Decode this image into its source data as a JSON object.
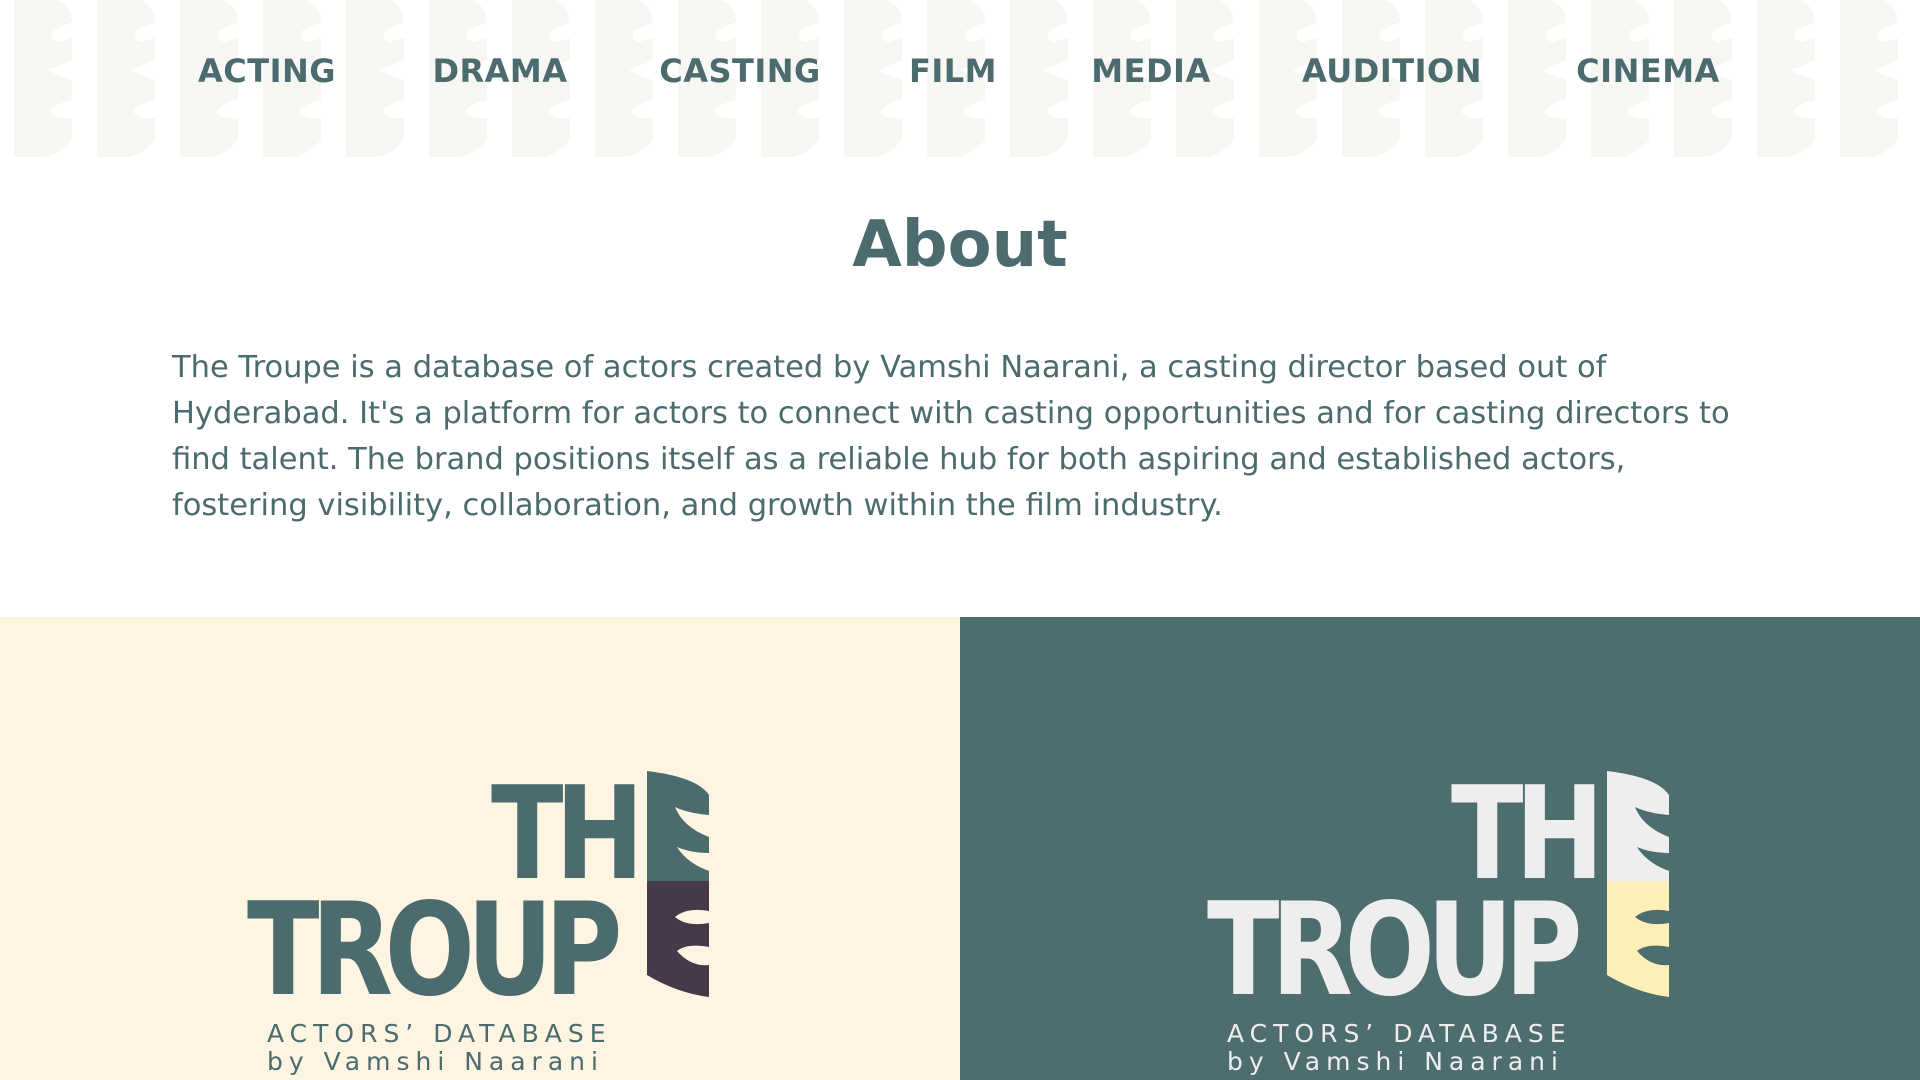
{
  "colors": {
    "teal": "#4b6b6e",
    "cream": "#fdf4e1",
    "plum": "#45394a",
    "light": "#eeeeee",
    "butter": "#fdefb8",
    "pattern": "#f6f6f3"
  },
  "nav": {
    "items": [
      {
        "label": "ACTING"
      },
      {
        "label": "DRAMA"
      },
      {
        "label": "CASTING"
      },
      {
        "label": "FILM"
      },
      {
        "label": "MEDIA"
      },
      {
        "label": "AUDITION"
      },
      {
        "label": "CINEMA"
      }
    ]
  },
  "about": {
    "title": "About",
    "body": "The Troupe is a database of actors created by Vamshi Naarani, a casting director based out of Hyderabad. It's a platform for actors to connect with casting opportunities and for casting directors to find talent. The brand positions itself as a reliable hub for both aspiring and established actors, fostering visibility, collaboration, and growth within the film industry."
  },
  "logo": {
    "word1": "THE",
    "word2": "TROUPE",
    "tagline1": "ACTORS’ DATABASE",
    "tagline2": "by Vamshi Naarani",
    "icon": "theatre-mask-icon"
  }
}
